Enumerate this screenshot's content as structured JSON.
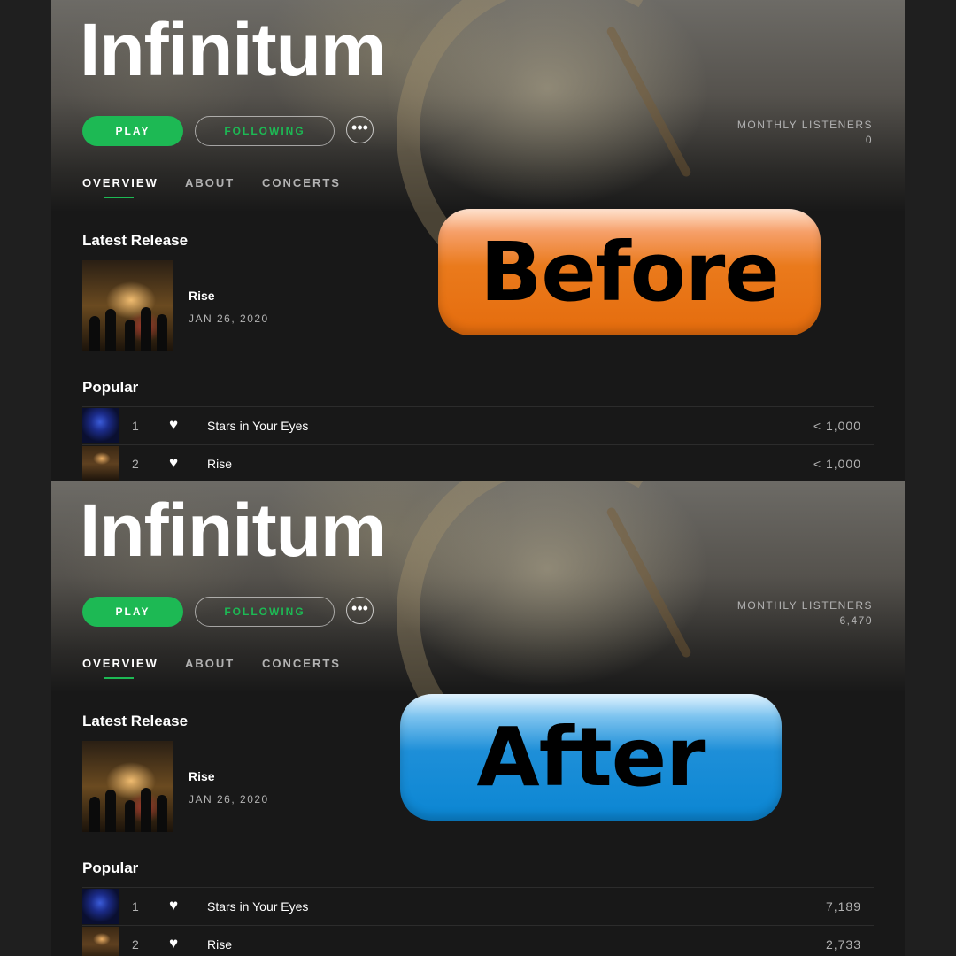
{
  "panels": [
    {
      "artist": "Infinitum",
      "buttons": {
        "play": "PLAY",
        "following": "FOLLOWING",
        "more": "•••"
      },
      "monthly_listeners": {
        "label": "MONTHLY LISTENERS",
        "value": "0"
      },
      "tabs": [
        "OVERVIEW",
        "ABOUT",
        "CONCERTS"
      ],
      "latest_release": {
        "section_title": "Latest Release",
        "name": "Rise",
        "date": "JAN 26, 2020"
      },
      "popular": {
        "section_title": "Popular",
        "tracks": [
          {
            "num": "1",
            "title": "Stars in Your Eyes",
            "plays": "< 1,000"
          },
          {
            "num": "2",
            "title": "Rise",
            "plays": "< 1,000"
          }
        ]
      }
    },
    {
      "artist": "Infinitum",
      "buttons": {
        "play": "PLAY",
        "following": "FOLLOWING",
        "more": "•••"
      },
      "monthly_listeners": {
        "label": "MONTHLY LISTENERS",
        "value": "6,470"
      },
      "tabs": [
        "OVERVIEW",
        "ABOUT",
        "CONCERTS"
      ],
      "latest_release": {
        "section_title": "Latest Release",
        "name": "Rise",
        "date": "JAN 26, 2020"
      },
      "popular": {
        "section_title": "Popular",
        "tracks": [
          {
            "num": "1",
            "title": "Stars in Your Eyes",
            "plays": "7,189"
          },
          {
            "num": "2",
            "title": "Rise",
            "plays": "2,733"
          }
        ]
      }
    }
  ],
  "labels": {
    "before": "Before",
    "after": "After"
  },
  "colors": {
    "accent": "#1db954",
    "before_badge": "#e56c0d",
    "after_badge": "#0b86d3"
  },
  "icons": {
    "heart": "heart-icon",
    "more": "more-icon"
  }
}
